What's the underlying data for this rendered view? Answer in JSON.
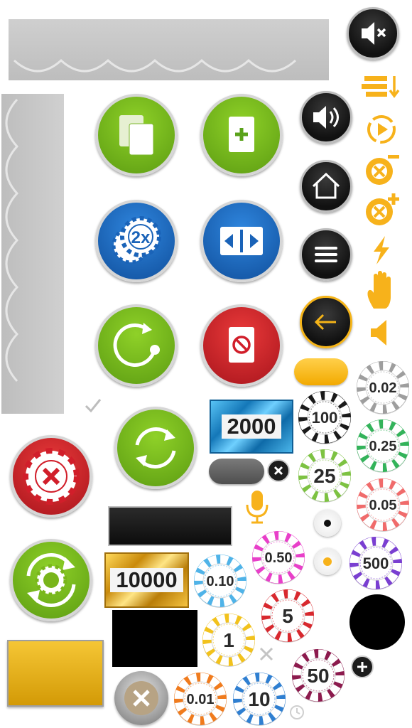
{
  "chips": {
    "c002": {
      "label": "0.02",
      "color": "#9e9e9e"
    },
    "c100": {
      "label": "100",
      "color": "#1a1a1a"
    },
    "c025": {
      "label": "0.25",
      "color": "#33b35a"
    },
    "c25": {
      "label": "25",
      "color": "#7dc242"
    },
    "c005": {
      "label": "0.05",
      "color": "#f06b6b"
    },
    "c050": {
      "label": "0.50",
      "color": "#e83fc9"
    },
    "c500": {
      "label": "500",
      "color": "#7a3fd1"
    },
    "c010": {
      "label": "0.10",
      "color": "#4fb3e8"
    },
    "c5": {
      "label": "5",
      "color": "#d8282e"
    },
    "c1": {
      "label": "1",
      "color": "#f2c21c"
    },
    "c50": {
      "label": "50",
      "color": "#8c1a4d"
    },
    "c001": {
      "label": "0.01",
      "color": "#f07b1d"
    },
    "c10": {
      "label": "10",
      "color": "#2f7fd1"
    }
  },
  "plaques": {
    "blue": {
      "label": "2000",
      "color": "#1f87c9"
    },
    "gold": {
      "label": "10000",
      "color": "#e1a81d"
    }
  },
  "double_label": "2x",
  "colors": {
    "green": "#79b51b",
    "blue": "#1a63b8",
    "red": "#d11e2a",
    "orange": "#f7b21b",
    "dark": "#1c1c1c"
  }
}
